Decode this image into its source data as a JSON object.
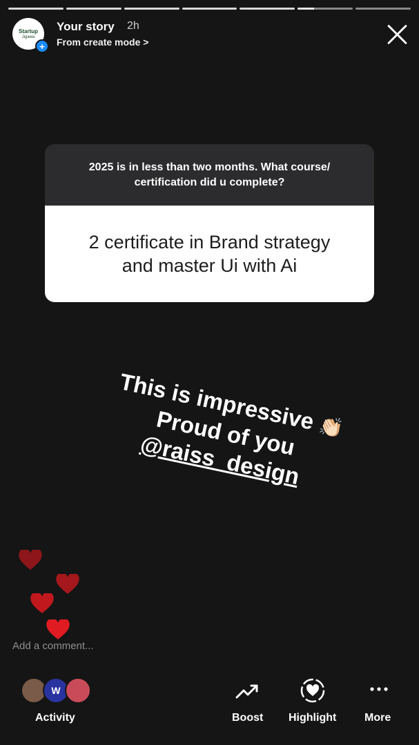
{
  "progress": {
    "total": 6,
    "completed": 5,
    "current_fraction": 0.3
  },
  "header": {
    "avatar_logo_line1": "Startup",
    "avatar_logo_line2": "Jigawa",
    "title": "Your story",
    "time": "2h",
    "subtitle": "From create mode >"
  },
  "question_card": {
    "question": "2025 is in less than two months. What course/ certification did u complete?",
    "answer": "2 certificate in Brand strategy and master Ui with Ai"
  },
  "overlay": {
    "line1": "This is impressive",
    "line1_emoji": "👏🏻",
    "line2": "Proud of you",
    "mention": "@raiss_design"
  },
  "comment": {
    "placeholder": "Add a comment..."
  },
  "bottom_bar": {
    "activity_label": "Activity",
    "activity_badge_letter": "W",
    "boost_label": "Boost",
    "highlight_label": "Highlight",
    "more_label": "More"
  },
  "colors": {
    "heart": "#d4191f",
    "plus_badge": "#1a8cff",
    "background": "#151515"
  }
}
